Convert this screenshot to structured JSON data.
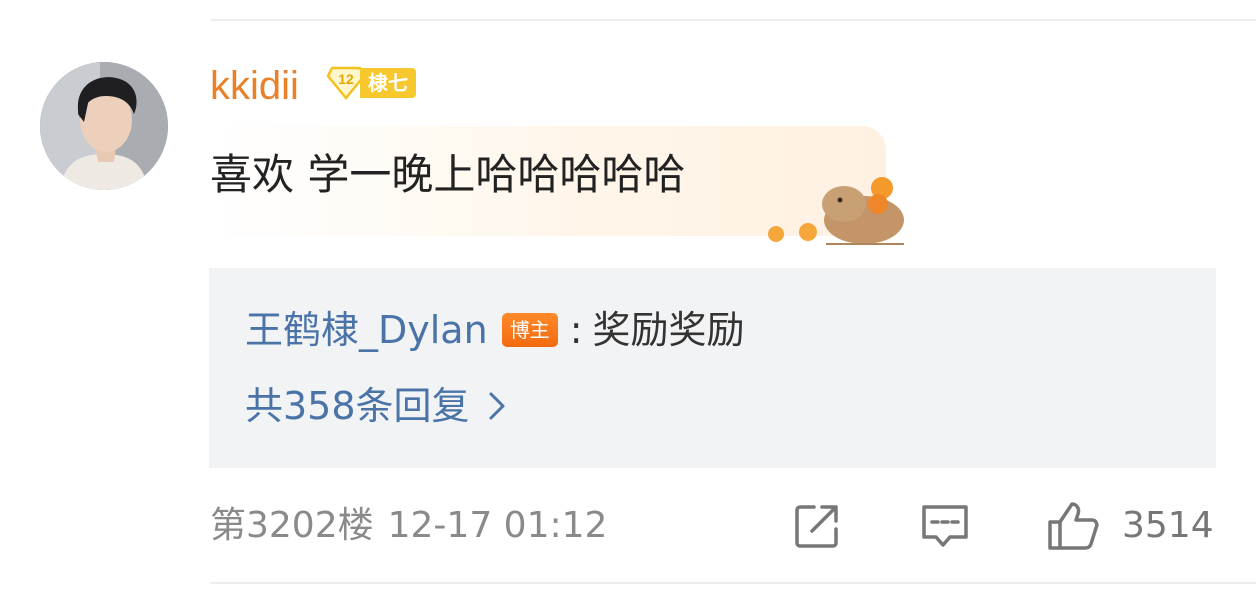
{
  "comment": {
    "username": "kkidii",
    "badge": {
      "level": "12",
      "name": "棣七",
      "color": "#f7c82d"
    },
    "text": "喜欢 学一晚上哈哈哈哈哈",
    "accent_color": "#e8812a"
  },
  "reply_preview": {
    "author": "王鹤棣_Dylan",
    "author_badge": "博主",
    "colon": ":",
    "text": "奖励奖励",
    "more_label": "共358条回复",
    "link_color": "#4a74a8"
  },
  "footer": {
    "floor": "第3202楼",
    "time": "12-17 01:12",
    "like_count": "3514"
  },
  "icons": {
    "share": "share-icon",
    "comment": "comment-icon",
    "like": "thumbs-up-icon",
    "chevron": "chevron-right-icon"
  }
}
